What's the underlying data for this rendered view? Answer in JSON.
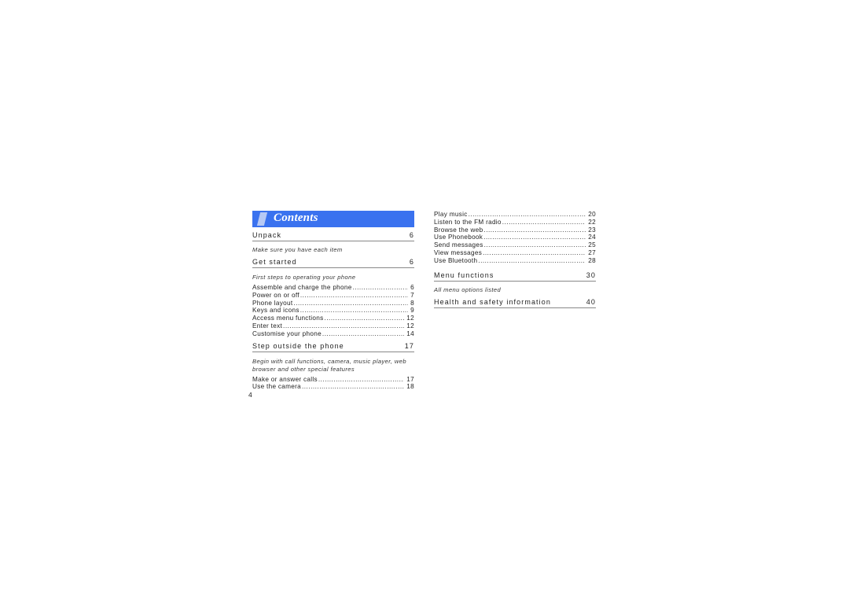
{
  "page_title": "Contents",
  "page_number": "4",
  "accent_color": "#3a72ef",
  "left_column": {
    "sections": [
      {
        "title": "Unpack",
        "page": "6",
        "description": "Make sure you have each item",
        "items": []
      },
      {
        "title": "Get started",
        "page": "6",
        "description": "First steps to operating your phone",
        "items": [
          {
            "label": "Assemble and charge the phone",
            "page": "6"
          },
          {
            "label": "Power on or off",
            "page": "7"
          },
          {
            "label": "Phone layout",
            "page": "8"
          },
          {
            "label": "Keys and icons",
            "page": "9"
          },
          {
            "label": "Access menu functions",
            "page": "12"
          },
          {
            "label": "Enter text",
            "page": "12"
          },
          {
            "label": "Customise your phone",
            "page": "14"
          }
        ]
      },
      {
        "title": "Step outside the phone",
        "page": "17",
        "description": "Begin with call functions, camera, music player, web browser and other special features",
        "items": [
          {
            "label": "Make or answer calls",
            "page": "17"
          },
          {
            "label": "Use the camera",
            "page": "18"
          }
        ]
      }
    ]
  },
  "right_column": {
    "items": [
      {
        "label": "Play music",
        "page": "20"
      },
      {
        "label": "Listen to the FM radio",
        "page": "22"
      },
      {
        "label": "Browse the web",
        "page": "23"
      },
      {
        "label": "Use Phonebook",
        "page": "24"
      },
      {
        "label": "Send messages",
        "page": "25"
      },
      {
        "label": "View messages",
        "page": "27"
      },
      {
        "label": "Use Bluetooth",
        "page": "28"
      }
    ],
    "sections": [
      {
        "title": "Menu functions",
        "page": "30",
        "description": "All menu options listed"
      },
      {
        "title": "Health and safety information",
        "page": "40",
        "description": ""
      }
    ]
  }
}
